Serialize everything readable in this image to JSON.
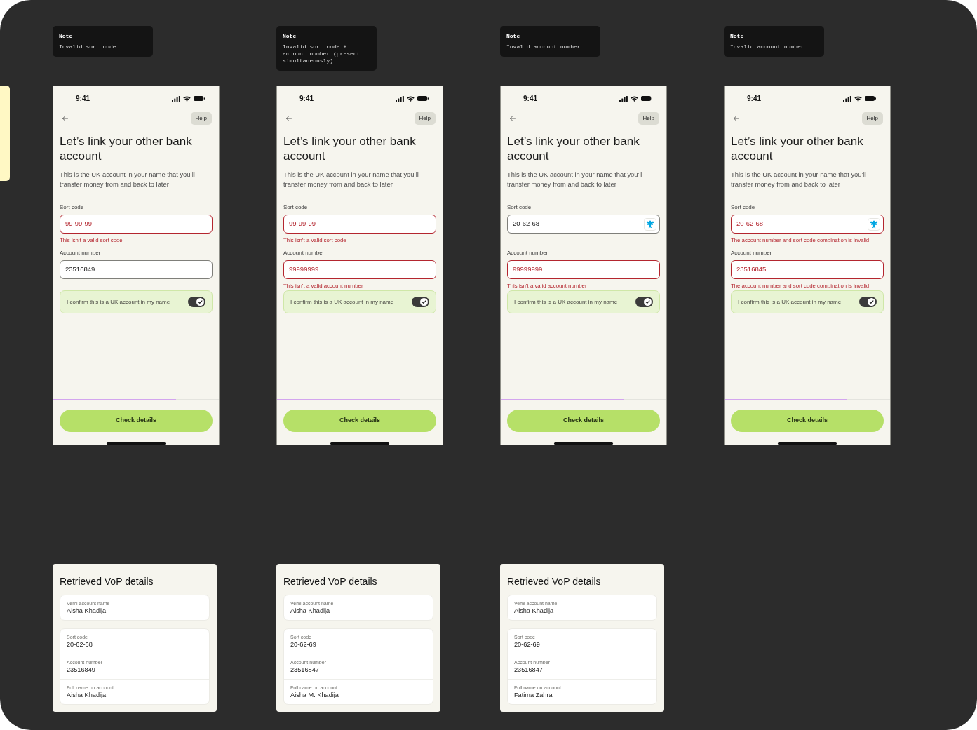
{
  "screens": [
    {
      "note": {
        "title": "Note",
        "text": "Invalid sort code"
      },
      "phone": {
        "time": "9:41",
        "help": "Help",
        "title": "Let’s link your other bank account",
        "description": "This is the UK account in your name that you’ll transfer money from and back to later",
        "fields": [
          {
            "label": "Sort code",
            "value": "99-99-99",
            "error": "This isn’t a valid sort code"
          },
          {
            "label": "Account number",
            "value": "23516849"
          }
        ],
        "confirm": {
          "label": "I confirm this is a UK account in my name",
          "on": true
        },
        "progress": {
          "level": 0.74
        },
        "button": "Check details"
      },
      "vop_details": {
        "title": "Retrieved VoP details",
        "account_name": {
          "label": "Vemi account name",
          "value": "Aisha Khadija"
        },
        "details": [
          {
            "label": "Sort code",
            "value": "20-62-68"
          },
          {
            "label": "Account number",
            "value": "23516849"
          },
          {
            "label": "Full name on account",
            "value": "Aisha Khadija"
          }
        ]
      }
    },
    {
      "note": {
        "title": "Note",
        "text": "Invalid sort code + account number (present simultaneously)"
      },
      "phone": {
        "time": "9:41",
        "help": "Help",
        "title": "Let’s link your other bank account",
        "description": "This is the UK account in your name that you’ll transfer money from and back to later",
        "fields": [
          {
            "label": "Sort code",
            "value": "99-99-99",
            "error": "This isn’t a valid sort code"
          },
          {
            "label": "Account number",
            "value": "99999999",
            "error": "This isn’t a valid account number"
          }
        ],
        "confirm": {
          "label": "I confirm this is a UK account in my name",
          "on": true
        },
        "progress": {
          "level": 0.74
        },
        "button": "Check details"
      },
      "vop_details": {
        "title": "Retrieved VoP details",
        "account_name": {
          "label": "Vemi account name",
          "value": "Aisha Khadija"
        },
        "details": [
          {
            "label": "Sort code",
            "value": "20-62-69"
          },
          {
            "label": "Account number",
            "value": "23516847"
          },
          {
            "label": "Full name on account",
            "value": "Aisha M. Khadija"
          }
        ]
      }
    },
    {
      "note": {
        "title": "Note",
        "text": "Invalid account number"
      },
      "phone": {
        "time": "9:41",
        "help": "Help",
        "title": "Let’s link your other bank account",
        "description": "This is the UK account in your name that you’ll transfer money from and back to later",
        "fields": [
          {
            "label": "Sort code",
            "value": "20-62-68",
            "bank_icon": true
          },
          {
            "label": "Account number",
            "value": "99999999",
            "error": "This isn’t a valid account number"
          }
        ],
        "confirm": {
          "label": "I confirm this is a UK account in my name",
          "on": true
        },
        "progress": {
          "level": 0.74
        },
        "button": "Check details"
      },
      "vop_details": {
        "title": "Retrieved VoP details",
        "account_name": {
          "label": "Vemi account name",
          "value": "Aisha Khadija"
        },
        "details": [
          {
            "label": "Sort code",
            "value": "20-62-69"
          },
          {
            "label": "Account number",
            "value": "23516847"
          },
          {
            "label": "Full name on account",
            "value": "Fatima Zahra"
          }
        ]
      }
    },
    {
      "note": {
        "title": "Note",
        "text": "Invalid account number"
      },
      "phone": {
        "time": "9:41",
        "help": "Help",
        "title": "Let’s link your other bank account",
        "description": "This is the UK account in your name that you’ll transfer money from and back to later",
        "fields": [
          {
            "label": "Sort code",
            "value": "20-62-68",
            "bank_icon": true,
            "error": "The account number and sort code combination is invalid"
          },
          {
            "label": "Account number",
            "value": "23516845",
            "error": "The account number and sort code combination is invalid"
          }
        ],
        "confirm": {
          "label": "I confirm this is a UK account in my name",
          "on": true
        },
        "progress": {
          "level": 0.74
        },
        "button": "Check details"
      }
    }
  ]
}
